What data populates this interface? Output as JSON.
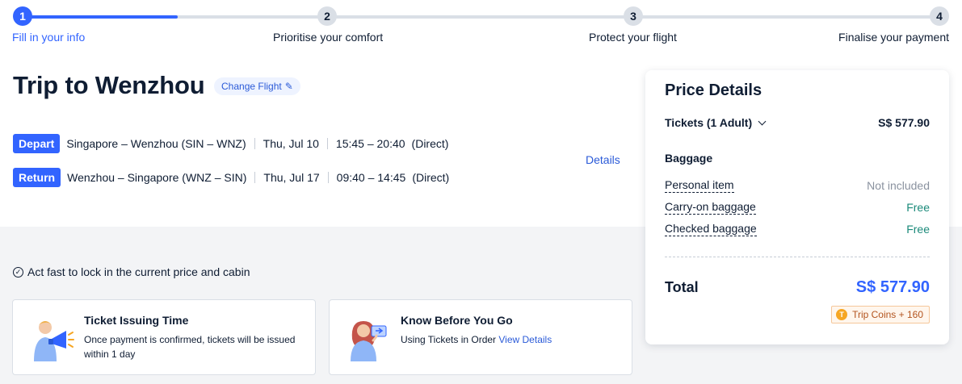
{
  "stepper": {
    "progress_fraction": 0.17,
    "steps": [
      {
        "number": "1",
        "label": "Fill in your info",
        "state": "active"
      },
      {
        "number": "2",
        "label": "Prioritise your comfort",
        "state": "pending"
      },
      {
        "number": "3",
        "label": "Protect your flight",
        "state": "pending"
      },
      {
        "number": "4",
        "label": "Finalise your payment",
        "state": "pending"
      }
    ]
  },
  "trip": {
    "title": "Trip to Wenzhou",
    "change_flight_label": "Change Flight",
    "details_label": "Details",
    "flights": [
      {
        "tag": "Depart",
        "route": "Singapore – Wenzhou (SIN – WNZ)",
        "date": "Thu, Jul 10",
        "time": "15:45 – 20:40",
        "stops": "(Direct)"
      },
      {
        "tag": "Return",
        "route": "Wenzhou – Singapore (WNZ – SIN)",
        "date": "Thu, Jul 17",
        "time": "09:40 – 14:45",
        "stops": "(Direct)"
      }
    ]
  },
  "notice": {
    "act_fast": "Act fast to lock in the current price and cabin"
  },
  "cards": [
    {
      "title": "Ticket Issuing Time",
      "text": "Once payment is confirmed, tickets will be issued within 1 day",
      "link": ""
    },
    {
      "title": "Know Before You Go",
      "text": "Using Tickets in Order",
      "link": "View Details"
    }
  ],
  "price": {
    "title": "Price Details",
    "tickets_label": "Tickets (1 Adult)",
    "tickets_value": "S$ 577.90",
    "baggage_title": "Baggage",
    "baggage": [
      {
        "label": "Personal item",
        "status": "Not included",
        "tone": "grey"
      },
      {
        "label": "Carry-on baggage",
        "status": "Free",
        "tone": "green"
      },
      {
        "label": "Checked baggage",
        "status": "Free",
        "tone": "green"
      }
    ],
    "total_label": "Total",
    "total_value": "S$ 577.90",
    "coins_label": "Trip Coins + 160"
  },
  "colors": {
    "accent": "#3264ff",
    "link": "#2a5ad8",
    "free_green": "#1b8a7a",
    "muted": "#8a929f",
    "coin_orange": "#f6a623"
  }
}
